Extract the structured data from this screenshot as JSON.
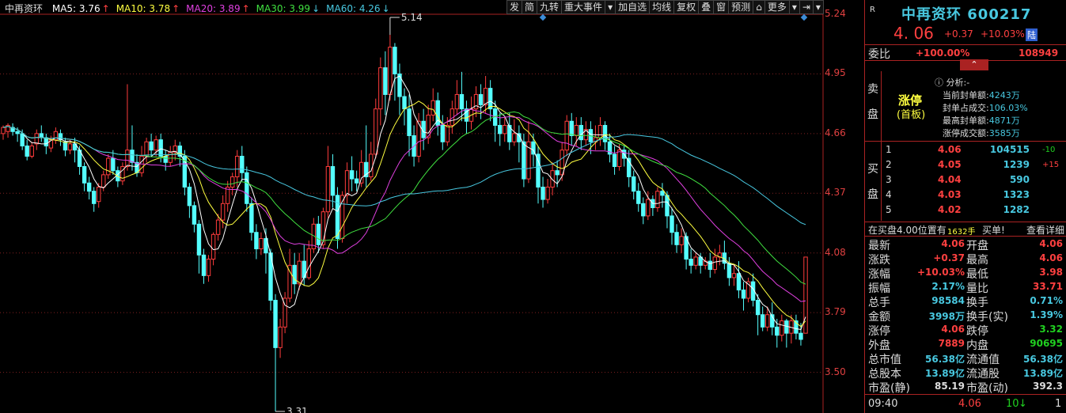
{
  "stock": {
    "name": "中再资环",
    "code": "600217"
  },
  "ma_legend": {
    "title": "中再资环",
    "items": [
      {
        "label": "MA5: 3.76",
        "arrow": "↑",
        "color": "#ffffff"
      },
      {
        "label": "MA10: 3.78",
        "arrow": "↑",
        "color": "#ffff40"
      },
      {
        "label": "MA20: 3.89",
        "arrow": "↑",
        "color": "#e040e0"
      },
      {
        "label": "MA30: 3.99",
        "arrow": "↓",
        "color": "#40e040"
      },
      {
        "label": "MA60: 4.26",
        "arrow": "↓",
        "color": "#48c8e0"
      }
    ]
  },
  "toolbar": [
    "发",
    "简",
    "九转",
    "重大事件",
    "▾",
    "加自选",
    "均线",
    "复权",
    "叠",
    "窗",
    "预测",
    "⌂",
    "更多",
    "▾",
    "⇥",
    "▾"
  ],
  "y_axis": [
    "5.24",
    "4.95",
    "4.66",
    "4.37",
    "4.08",
    "3.79",
    "3.50"
  ],
  "chart_data": {
    "type": "candlestick",
    "ylim": [
      3.31,
      5.24
    ],
    "annotations": {
      "high": "5.14",
      "low": "3.31"
    },
    "candles": [
      [
        4.66,
        4.69,
        4.63,
        4.7
      ],
      [
        4.67,
        4.7,
        4.64,
        4.71
      ],
      [
        4.69,
        4.67,
        4.65,
        4.71
      ],
      [
        4.67,
        4.66,
        4.62,
        4.69
      ],
      [
        4.66,
        4.6,
        4.58,
        4.68
      ],
      [
        4.6,
        4.55,
        4.53,
        4.63
      ],
      [
        4.55,
        4.6,
        4.54,
        4.62
      ],
      [
        4.61,
        4.66,
        4.58,
        4.68
      ],
      [
        4.66,
        4.64,
        4.62,
        4.7
      ],
      [
        4.64,
        4.6,
        4.56,
        4.66
      ],
      [
        4.59,
        4.63,
        4.57,
        4.65
      ],
      [
        4.63,
        4.67,
        4.61,
        4.69
      ],
      [
        4.66,
        4.63,
        4.6,
        4.68
      ],
      [
        4.62,
        4.58,
        4.55,
        4.64
      ],
      [
        4.58,
        4.61,
        4.56,
        4.63
      ],
      [
        4.61,
        4.58,
        4.52,
        4.64
      ],
      [
        4.58,
        4.5,
        4.46,
        4.6
      ],
      [
        4.5,
        4.42,
        4.38,
        4.52
      ],
      [
        4.42,
        4.38,
        4.34,
        4.45
      ],
      [
        4.38,
        4.32,
        4.28,
        4.4
      ],
      [
        4.33,
        4.4,
        4.3,
        4.42
      ],
      [
        4.4,
        4.46,
        4.38,
        4.48
      ],
      [
        4.46,
        4.54,
        4.44,
        4.56
      ],
      [
        4.54,
        4.48,
        4.46,
        4.58
      ],
      [
        4.48,
        4.43,
        4.4,
        4.5
      ],
      [
        4.43,
        4.5,
        4.41,
        4.52
      ],
      [
        4.5,
        4.58,
        4.48,
        4.9
      ],
      [
        4.58,
        4.52,
        4.48,
        4.7
      ],
      [
        4.52,
        4.47,
        4.45,
        4.56
      ],
      [
        4.47,
        4.55,
        4.45,
        4.6
      ],
      [
        4.55,
        4.62,
        4.52,
        4.64
      ],
      [
        4.62,
        4.58,
        4.55,
        4.66
      ],
      [
        4.58,
        4.63,
        4.55,
        4.65
      ],
      [
        4.63,
        4.55,
        4.52,
        4.66
      ],
      [
        4.55,
        4.52,
        4.48,
        4.58
      ],
      [
        4.52,
        4.57,
        4.5,
        4.6
      ],
      [
        4.57,
        4.6,
        4.53,
        4.63
      ],
      [
        4.6,
        4.55,
        4.5,
        4.62
      ],
      [
        4.55,
        4.4,
        4.36,
        4.58
      ],
      [
        4.4,
        4.31,
        4.25,
        4.42
      ],
      [
        4.31,
        4.22,
        4.18,
        4.33
      ],
      [
        4.22,
        4.07,
        3.98,
        4.24
      ],
      [
        4.07,
        3.97,
        3.93,
        4.1
      ],
      [
        3.97,
        4.05,
        3.94,
        4.07
      ],
      [
        4.05,
        4.17,
        4.02,
        4.18
      ],
      [
        4.17,
        4.24,
        4.14,
        4.27
      ],
      [
        4.24,
        4.32,
        4.2,
        4.36
      ],
      [
        4.32,
        4.4,
        4.28,
        4.43
      ],
      [
        4.4,
        4.45,
        4.36,
        4.47
      ],
      [
        4.45,
        4.55,
        4.4,
        4.58
      ],
      [
        4.55,
        4.47,
        4.43,
        4.6
      ],
      [
        4.47,
        4.32,
        4.28,
        4.5
      ],
      [
        4.32,
        4.18,
        4.14,
        4.35
      ],
      [
        4.18,
        4.1,
        4.05,
        4.22
      ],
      [
        4.1,
        4.15,
        4.07,
        4.18
      ],
      [
        4.15,
        4.08,
        3.98,
        4.2
      ],
      [
        4.08,
        3.85,
        3.8,
        4.1
      ],
      [
        3.85,
        3.62,
        3.31,
        3.88
      ],
      [
        3.62,
        3.72,
        3.57,
        3.76
      ],
      [
        3.72,
        3.86,
        3.69,
        3.89
      ],
      [
        3.86,
        4.02,
        3.84,
        4.1
      ],
      [
        4.02,
        3.93,
        3.88,
        4.08
      ],
      [
        3.93,
        4.04,
        3.9,
        4.08
      ],
      [
        4.04,
        3.96,
        3.92,
        4.12
      ],
      [
        3.96,
        4.1,
        3.95,
        4.14
      ],
      [
        4.1,
        4.22,
        4.08,
        4.25
      ],
      [
        4.22,
        4.12,
        4.08,
        4.26
      ],
      [
        4.12,
        4.28,
        4.1,
        4.3
      ],
      [
        4.28,
        4.5,
        4.25,
        4.6
      ],
      [
        4.5,
        4.36,
        4.3,
        4.56
      ],
      [
        4.36,
        4.15,
        4.1,
        4.4
      ],
      [
        4.15,
        4.36,
        4.13,
        4.38
      ],
      [
        4.36,
        4.48,
        4.32,
        4.52
      ],
      [
        4.48,
        4.44,
        4.38,
        4.55
      ],
      [
        4.44,
        4.42,
        4.38,
        4.48
      ],
      [
        4.42,
        4.52,
        4.4,
        4.58
      ],
      [
        4.52,
        4.45,
        4.4,
        4.7
      ],
      [
        4.45,
        4.56,
        4.43,
        4.62
      ],
      [
        4.56,
        4.78,
        4.54,
        4.83
      ],
      [
        4.78,
        4.98,
        4.7,
        5.03
      ],
      [
        4.98,
        4.85,
        4.75,
        5.06
      ],
      [
        4.85,
        5.08,
        4.82,
        5.14
      ],
      [
        5.08,
        4.95,
        4.82,
        5.1
      ],
      [
        4.95,
        4.84,
        4.75,
        5.0
      ],
      [
        4.84,
        4.78,
        4.7,
        4.88
      ],
      [
        4.78,
        4.65,
        4.55,
        4.85
      ],
      [
        4.65,
        4.55,
        4.5,
        4.7
      ],
      [
        4.55,
        4.72,
        4.52,
        4.76
      ],
      [
        4.72,
        4.64,
        4.58,
        4.78
      ],
      [
        4.64,
        4.75,
        4.61,
        4.8
      ],
      [
        4.75,
        4.82,
        4.72,
        4.88
      ],
      [
        4.82,
        4.7,
        4.65,
        4.86
      ],
      [
        4.7,
        4.62,
        4.58,
        4.75
      ],
      [
        4.62,
        4.7,
        4.6,
        4.74
      ],
      [
        4.7,
        4.78,
        4.66,
        4.82
      ],
      [
        4.78,
        4.85,
        4.75,
        4.92
      ],
      [
        4.85,
        4.78,
        4.72,
        4.96
      ],
      [
        4.78,
        4.72,
        4.66,
        4.82
      ],
      [
        4.72,
        4.78,
        4.68,
        4.84
      ],
      [
        4.78,
        4.85,
        4.74,
        4.89
      ],
      [
        4.85,
        4.8,
        4.73,
        4.9
      ],
      [
        4.8,
        4.88,
        4.76,
        4.94
      ],
      [
        4.88,
        4.78,
        4.72,
        4.92
      ],
      [
        4.78,
        4.7,
        4.62,
        4.82
      ],
      [
        4.7,
        4.66,
        4.6,
        4.76
      ],
      [
        4.66,
        4.7,
        4.62,
        4.74
      ],
      [
        4.7,
        4.62,
        4.58,
        4.76
      ],
      [
        4.62,
        4.66,
        4.6,
        4.73
      ],
      [
        4.66,
        4.62,
        4.52,
        4.7
      ],
      [
        4.62,
        4.44,
        4.4,
        4.66
      ],
      [
        4.44,
        4.62,
        4.42,
        4.72
      ],
      [
        4.62,
        4.56,
        4.5,
        4.66
      ],
      [
        4.56,
        4.4,
        4.32,
        4.6
      ],
      [
        4.4,
        4.34,
        4.3,
        4.45
      ],
      [
        4.34,
        4.4,
        4.32,
        4.44
      ],
      [
        4.4,
        4.48,
        4.36,
        4.52
      ],
      [
        4.48,
        4.46,
        4.4,
        4.53
      ],
      [
        4.46,
        4.58,
        4.43,
        4.62
      ],
      [
        4.58,
        4.72,
        4.55,
        4.75
      ],
      [
        4.72,
        4.65,
        4.6,
        4.76
      ],
      [
        4.65,
        4.7,
        4.6,
        4.74
      ],
      [
        4.7,
        4.63,
        4.58,
        4.74
      ],
      [
        4.63,
        4.68,
        4.6,
        4.72
      ],
      [
        4.68,
        4.62,
        4.56,
        4.72
      ],
      [
        4.62,
        4.64,
        4.58,
        4.7
      ],
      [
        4.64,
        4.7,
        4.6,
        4.74
      ],
      [
        4.7,
        4.62,
        4.58,
        4.72
      ],
      [
        4.62,
        4.56,
        4.52,
        4.66
      ],
      [
        4.56,
        4.5,
        4.46,
        4.6
      ],
      [
        4.5,
        4.58,
        4.48,
        4.61
      ],
      [
        4.58,
        4.54,
        4.5,
        4.6
      ],
      [
        4.54,
        4.45,
        4.4,
        4.58
      ],
      [
        4.45,
        4.38,
        4.34,
        4.48
      ],
      [
        4.38,
        4.32,
        4.28,
        4.42
      ],
      [
        4.32,
        4.26,
        4.22,
        4.35
      ],
      [
        4.26,
        4.34,
        4.24,
        4.38
      ],
      [
        4.34,
        4.3,
        4.26,
        4.36
      ],
      [
        4.3,
        4.38,
        4.28,
        4.4
      ],
      [
        4.38,
        4.36,
        4.3,
        4.42
      ],
      [
        4.36,
        4.26,
        4.2,
        4.38
      ],
      [
        4.26,
        4.18,
        4.12,
        4.3
      ],
      [
        4.18,
        4.12,
        4.08,
        4.22
      ],
      [
        4.12,
        4.16,
        4.08,
        4.2
      ],
      [
        4.16,
        4.05,
        4.0,
        4.18
      ],
      [
        4.05,
        4.02,
        3.98,
        4.1
      ],
      [
        4.02,
        4.06,
        4.0,
        4.08
      ],
      [
        4.06,
        4.02,
        3.98,
        4.08
      ],
      [
        4.02,
        4.04,
        4.0,
        4.06
      ],
      [
        4.04,
        4.0,
        3.96,
        4.08
      ],
      [
        4.0,
        4.06,
        3.98,
        4.1
      ],
      [
        4.06,
        4.08,
        4.02,
        4.12
      ],
      [
        4.08,
        4.03,
        4.0,
        4.14
      ],
      [
        4.03,
        3.96,
        3.92,
        4.06
      ],
      [
        3.96,
        3.98,
        3.92,
        4.02
      ],
      [
        3.98,
        3.9,
        3.86,
        4.04
      ],
      [
        3.9,
        3.86,
        3.8,
        3.94
      ],
      [
        3.86,
        3.94,
        3.84,
        3.96
      ],
      [
        3.94,
        3.85,
        3.82,
        3.98
      ],
      [
        3.85,
        3.78,
        3.68,
        3.88
      ],
      [
        3.78,
        3.72,
        3.7,
        3.82
      ],
      [
        3.72,
        3.78,
        3.7,
        3.82
      ],
      [
        3.78,
        3.72,
        3.68,
        3.84
      ],
      [
        3.72,
        3.68,
        3.62,
        3.76
      ],
      [
        3.68,
        3.75,
        3.65,
        3.78
      ],
      [
        3.75,
        3.69,
        3.62,
        3.76
      ],
      [
        3.69,
        3.75,
        3.64,
        3.78
      ],
      [
        3.75,
        3.69,
        3.66,
        3.78
      ],
      [
        3.69,
        3.66,
        3.63,
        3.74
      ],
      [
        3.69,
        4.06,
        3.69,
        4.06
      ]
    ]
  },
  "panel": {
    "r_label": "R",
    "price": "4. 06",
    "change": "+0.37",
    "change_pct": "+10.03%",
    "flag": "陆",
    "weibi": {
      "label": "委比",
      "pct": "+100.00%",
      "value": "108949"
    },
    "sell_label": [
      "卖",
      "盘"
    ],
    "buy_label": [
      "买",
      "盘"
    ],
    "limit_tag": {
      "title": "涨停",
      "sub": "(首板)"
    },
    "analysis": [
      {
        "label": "分析:-"
      },
      {
        "label": "当前封单额:",
        "value": "4243万"
      },
      {
        "label": "封单占成交:",
        "value": "106.03%"
      },
      {
        "label": "最高封单额:",
        "value": "4871万"
      },
      {
        "label": "涨停成交额:",
        "value": "3585万"
      }
    ],
    "bids": [
      {
        "n": "1",
        "price": "4.06",
        "vol": "104515",
        "chg": "-10"
      },
      {
        "n": "2",
        "price": "4.05",
        "vol": "1239",
        "chg": "+15"
      },
      {
        "n": "3",
        "price": "4.04",
        "vol": "590",
        "chg": ""
      },
      {
        "n": "4",
        "price": "4.03",
        "vol": "1323",
        "chg": ""
      },
      {
        "n": "5",
        "price": "4.02",
        "vol": "1282",
        "chg": ""
      }
    ],
    "buyline": {
      "left": "在买盘4.00位置有",
      "qty": "1632手",
      "mid": "买单!",
      "link": "查看详细"
    },
    "stats": [
      [
        "最新",
        "4.06",
        "开盘",
        "4.06"
      ],
      [
        "涨跌",
        "+0.37",
        "最高",
        "4.06"
      ],
      [
        "涨幅",
        "+10.03%",
        "最低",
        "3.98"
      ],
      [
        "振幅",
        "2.17%",
        "量比",
        "33.71"
      ],
      [
        "总手",
        "98584",
        "换手",
        "0.71%"
      ],
      [
        "金额",
        "3998万",
        "换手(实)",
        "1.39%"
      ],
      [
        "涨停",
        "4.06",
        "跌停",
        "3.32"
      ],
      [
        "外盘",
        "7889",
        "内盘",
        "90695"
      ],
      [
        "总市值",
        "56.38亿",
        "流通值",
        "56.38亿"
      ],
      [
        "总股本",
        "13.89亿",
        "流通股",
        "13.89亿"
      ],
      [
        "市盈(静)",
        "85.19",
        "市盈(动)",
        "392.3"
      ]
    ],
    "tick": {
      "time": "09:40",
      "price": "4.06",
      "vol": "10",
      "arrow": "↓",
      "n": "1"
    }
  }
}
